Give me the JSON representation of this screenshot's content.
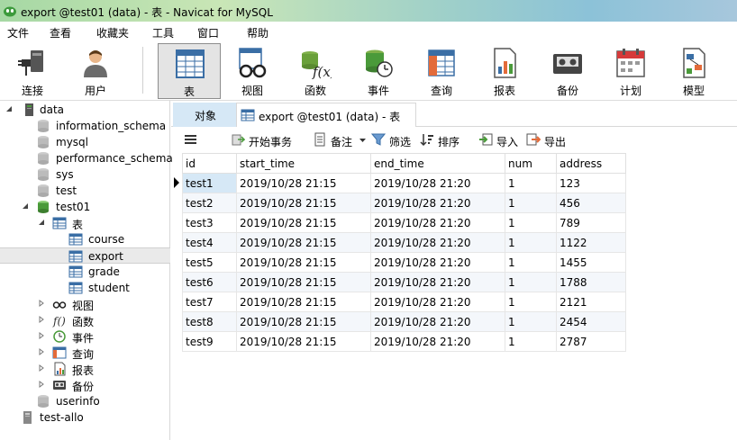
{
  "window": {
    "title": "export @test01 (data) - 表 - Navicat for MySQL"
  },
  "menu": [
    "文件",
    "查看",
    "收藏夹",
    "工具",
    "窗口",
    "帮助"
  ],
  "toolbar": [
    {
      "label": "连接",
      "icon": "connect-plug-icon"
    },
    {
      "label": "用户",
      "icon": "user-icon"
    },
    {
      "label": "表",
      "icon": "table-icon",
      "active": true
    },
    {
      "label": "视图",
      "icon": "view-glasses-icon"
    },
    {
      "label": "函数",
      "icon": "function-icon"
    },
    {
      "label": "事件",
      "icon": "event-clock-icon"
    },
    {
      "label": "查询",
      "icon": "query-icon"
    },
    {
      "label": "报表",
      "icon": "report-icon"
    },
    {
      "label": "备份",
      "icon": "backup-tape-icon"
    },
    {
      "label": "计划",
      "icon": "schedule-calendar-icon"
    },
    {
      "label": "模型",
      "icon": "model-icon"
    }
  ],
  "tree": {
    "connection": "data",
    "databases": [
      "information_schema",
      "mysql",
      "performance_schema",
      "sys",
      "test",
      "test01"
    ],
    "tables_folder": "表",
    "tables": [
      "course",
      "export",
      "grade",
      "student"
    ],
    "folders": [
      "视图",
      "函数",
      "事件",
      "查询",
      "报表",
      "备份"
    ],
    "after": "userinfo",
    "connection2": "test-allo"
  },
  "tabs": {
    "objects": "对象",
    "active": "export @test01 (data) - 表"
  },
  "subtoolbar": {
    "begin_transaction": "开始事务",
    "note": "备注",
    "filter": "筛选",
    "sort": "排序",
    "import": "导入",
    "export": "导出"
  },
  "grid": {
    "columns": [
      "id",
      "start_time",
      "end_time",
      "num",
      "address"
    ],
    "rows": [
      [
        "test1",
        "2019/10/28 21:15",
        "2019/10/28 21:20",
        "1",
        "123"
      ],
      [
        "test2",
        "2019/10/28 21:15",
        "2019/10/28 21:20",
        "1",
        "456"
      ],
      [
        "test3",
        "2019/10/28 21:15",
        "2019/10/28 21:20",
        "1",
        "789"
      ],
      [
        "test4",
        "2019/10/28 21:15",
        "2019/10/28 21:20",
        "1",
        "1122"
      ],
      [
        "test5",
        "2019/10/28 21:15",
        "2019/10/28 21:20",
        "1",
        "1455"
      ],
      [
        "test6",
        "2019/10/28 21:15",
        "2019/10/28 21:20",
        "1",
        "1788"
      ],
      [
        "test7",
        "2019/10/28 21:15",
        "2019/10/28 21:20",
        "1",
        "2121"
      ],
      [
        "test8",
        "2019/10/28 21:15",
        "2019/10/28 21:20",
        "1",
        "2454"
      ],
      [
        "test9",
        "2019/10/28 21:15",
        "2019/10/28 21:20",
        "1",
        "2787"
      ]
    ]
  }
}
